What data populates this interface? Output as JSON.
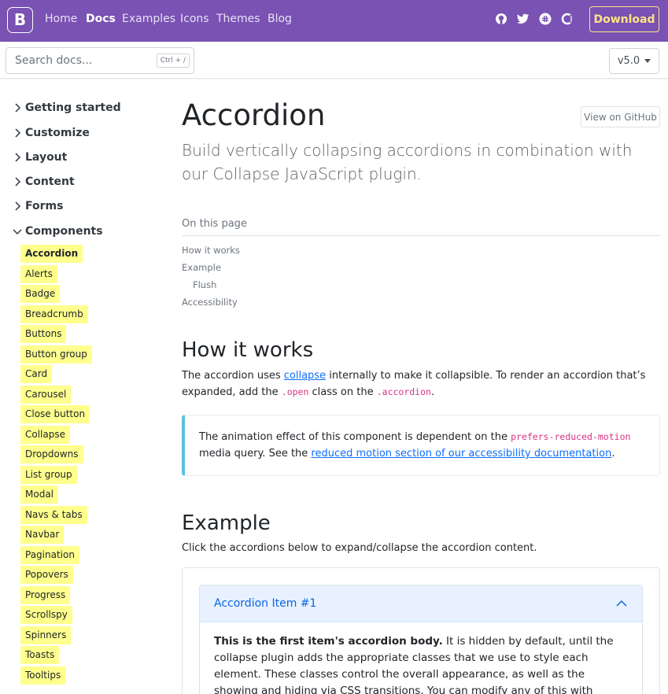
{
  "navbar": {
    "brand": "B",
    "links": [
      "Home",
      "Docs",
      "Examples",
      "Icons",
      "Themes",
      "Blog"
    ],
    "active": "Docs",
    "download_label": "Download",
    "social_icons": [
      "github-icon",
      "twitter-icon",
      "slack-icon",
      "opencollective-icon"
    ],
    "colors": {
      "bg": "#7952b3",
      "download": "#ffe484"
    }
  },
  "subnav": {
    "search_placeholder": "Search docs...",
    "search_shortcut": "Ctrl + /",
    "version": "v5.0"
  },
  "sidebar": {
    "groups": [
      "Getting started",
      "Customize",
      "Layout",
      "Content",
      "Forms",
      "Components"
    ],
    "expanded_group": "Components",
    "components": [
      "Accordion",
      "Alerts",
      "Badge",
      "Breadcrumb",
      "Buttons",
      "Button group",
      "Card",
      "Carousel",
      "Close button",
      "Collapse",
      "Dropdowns",
      "List group",
      "Modal",
      "Navs & tabs",
      "Navbar",
      "Pagination",
      "Popovers",
      "Progress",
      "Scrollspy",
      "Spinners",
      "Toasts",
      "Tooltips"
    ],
    "active_item": "Accordion",
    "highlight_color": "#ffff8d"
  },
  "main": {
    "title": "Accordion",
    "github_button": "View on GitHub",
    "lead": "Build vertically collapsing accordions in combination with our Collapse JavaScript plugin.",
    "toc": {
      "title": "On this page",
      "items": [
        "How it works",
        "Example",
        "Flush",
        "Accessibility"
      ]
    },
    "how_it_works": {
      "heading": "How it works",
      "text_1": "The accordion uses ",
      "link_collapse": "collapse",
      "text_2": " internally to make it collapsible. To render an accordion that’s expanded, add the ",
      "code_open": ".open",
      "text_3": " class on the ",
      "code_accordion": ".accordion",
      "text_4": "."
    },
    "callout": {
      "text_1": "The animation effect of this component is dependent on the ",
      "code": "prefers-reduced-motion",
      "text_2": " media query. See the ",
      "link": "reduced motion section of our accessibility documentation",
      "text_3": "."
    },
    "example": {
      "heading": "Example",
      "intro": "Click the accordions below to expand/collapse the accordion content.",
      "item_title": "Accordion Item #1",
      "body_bold": "This is the first item's accordion body.",
      "body_text": " It is hidden by default, until the collapse plugin adds the appropriate classes that we use to style each element. These classes control the overall appearance, as well as the showing and hiding via CSS transitions. You can modify any of this with custom CSS or overriding our default variables. It's"
    }
  }
}
